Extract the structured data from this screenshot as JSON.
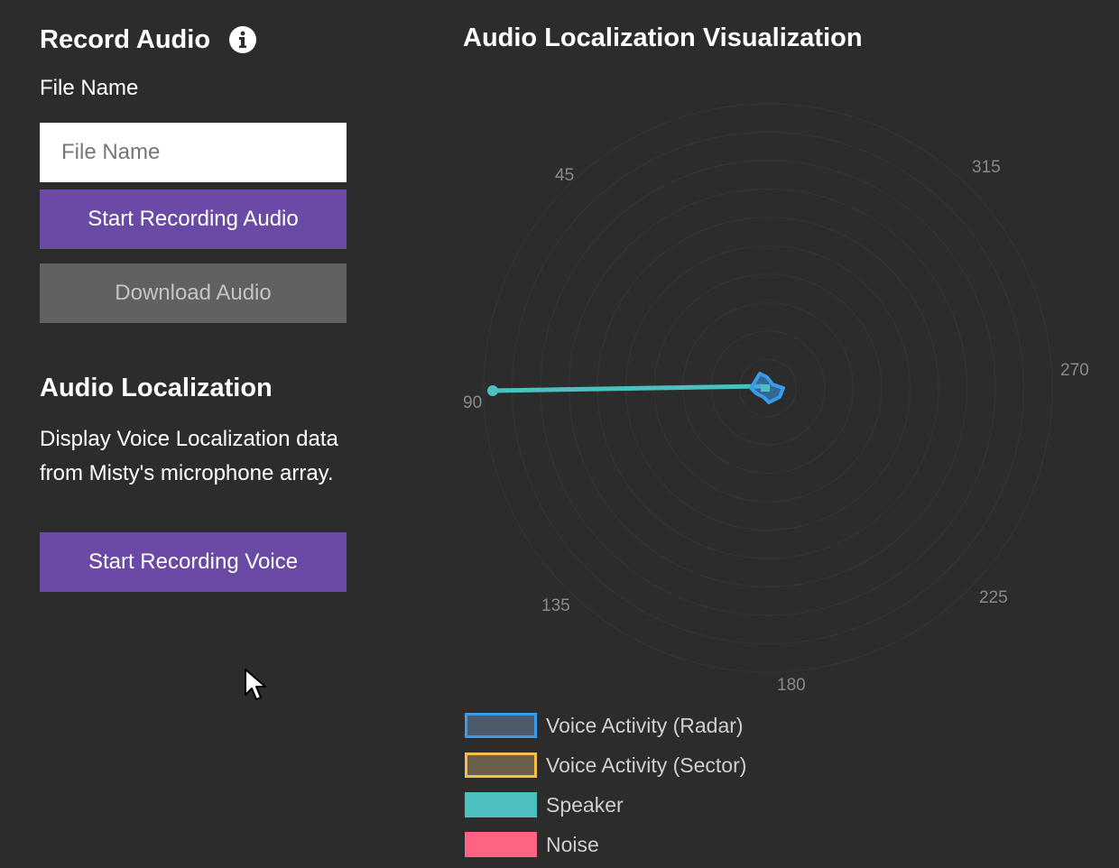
{
  "record_audio": {
    "title": "Record Audio",
    "file_name_label": "File Name",
    "file_name_placeholder": "File Name",
    "file_name_value": "",
    "start_button": "Start Recording Audio",
    "download_button": "Download Audio"
  },
  "audio_localization": {
    "title": "Audio Localization",
    "description": "Display Voice Localization data from Misty's microphone array.",
    "start_button": "Start Recording Voice"
  },
  "visualization": {
    "title": "Audio Localization Visualization",
    "angle_labels": [
      "45",
      "315",
      "270",
      "90",
      "225",
      "135",
      "180"
    ],
    "legend": [
      {
        "label": "Voice Activity (Radar)",
        "fill": "#4b5b6b",
        "border": "#3a9be8"
      },
      {
        "label": "Voice Activity (Sector)",
        "fill": "#6b5e4a",
        "border": "#f5c04a"
      },
      {
        "label": "Speaker",
        "fill": "#4bc0c0",
        "border": "#4bc0c0"
      },
      {
        "label": "Noise",
        "fill": "#ff6384",
        "border": "#ff6384"
      }
    ],
    "speaker_angle_deg": 90,
    "colors": {
      "speaker": "#4bc0c0",
      "voice_activity_radar": "#3a9be8",
      "grid": "#333333"
    }
  }
}
